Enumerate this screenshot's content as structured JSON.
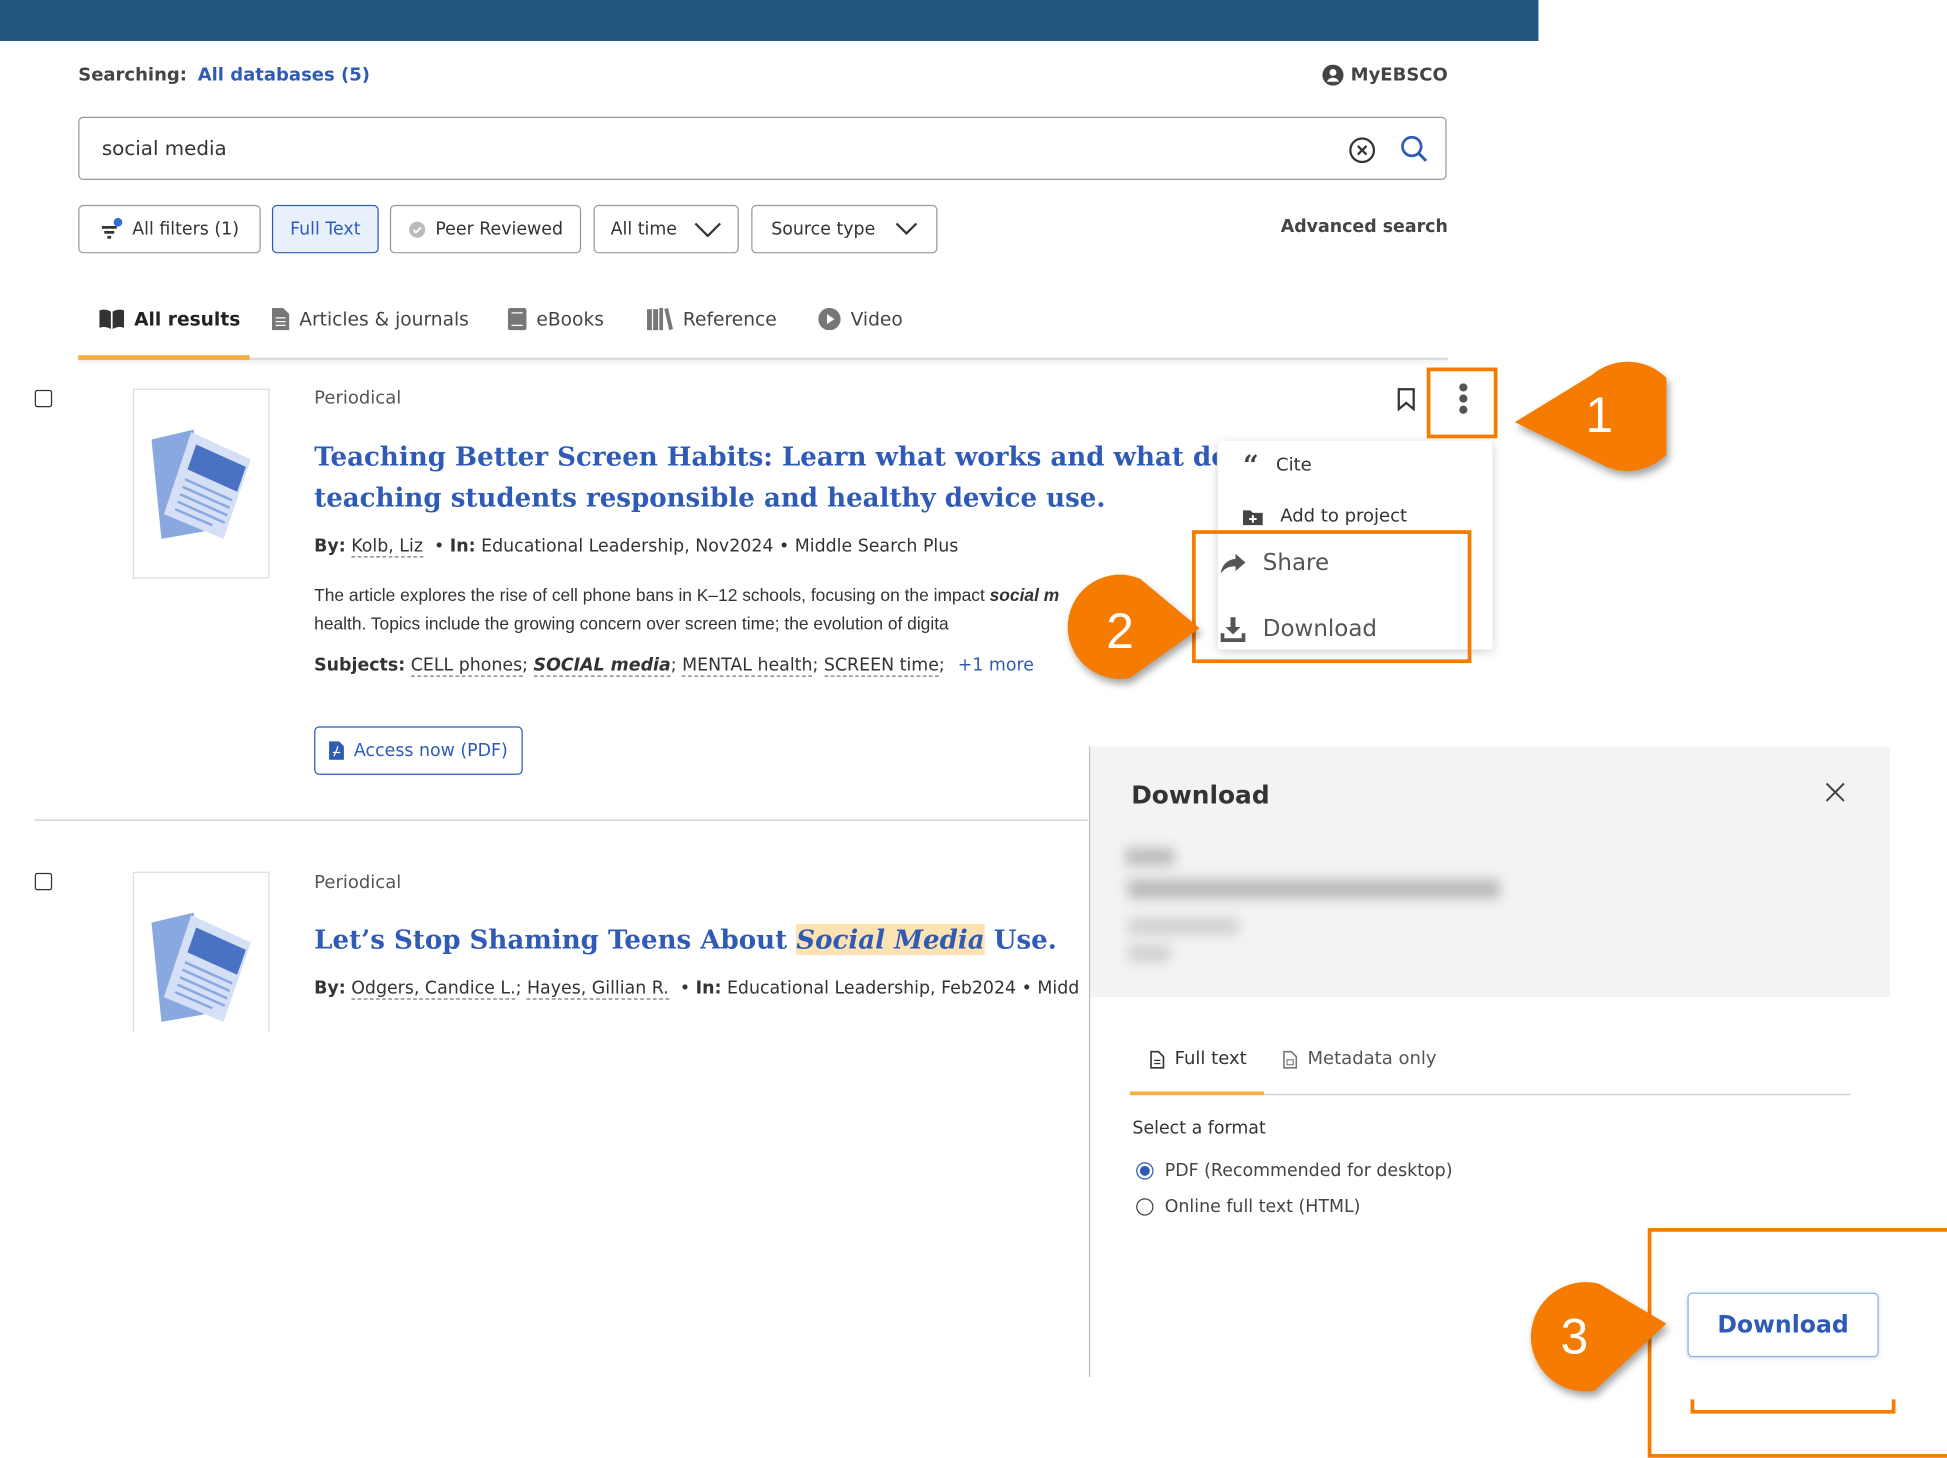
{
  "header": {
    "searching_label": "Searching:",
    "databases_link": "All databases (5)",
    "account_label": "MyEBSCO"
  },
  "search": {
    "value": "social media"
  },
  "filters": {
    "all_filters": "All filters (1)",
    "full_text": "Full Text",
    "peer_reviewed": "Peer Reviewed",
    "all_time": "All time",
    "source_type": "Source type",
    "advanced_search": "Advanced search"
  },
  "tabs": [
    {
      "label": "All results"
    },
    {
      "label": "Articles & journals"
    },
    {
      "label": "eBooks"
    },
    {
      "label": "Reference"
    },
    {
      "label": "Video"
    }
  ],
  "results": [
    {
      "type": "Periodical",
      "title_line1": "Teaching Better Screen Habits: Learn what works and what doesn",
      "title_line2": "teaching students responsible and healthy device use.",
      "by_label": "By:",
      "author": "Kolb, Liz",
      "in_label": "In:",
      "source": "Educational Leadership, Nov2024 • Middle Search Plus",
      "abstract_line1": "The article explores the rise of cell phone bans in K–12 schools, focusing on the impact",
      "abstract_line1_em": "social m",
      "abstract_line2": "health. Topics include the growing concern over screen time; the evolution of digita",
      "subjects_label": "Subjects:",
      "subjects": [
        "CELL phones",
        "SOCIAL media",
        "MENTAL health",
        "SCREEN time"
      ],
      "more": "+1 more",
      "access_button": "Access now (PDF)"
    },
    {
      "type": "Periodical",
      "title_before": "Let’s Stop Shaming Teens About ",
      "title_highlight": "Social Media",
      "title_after": " Use.",
      "by_label": "By:",
      "authors": [
        "Odgers, Candice L.",
        "Hayes, Gillian R."
      ],
      "in_label": "In:",
      "source": "Educational Leadership, Feb2024 • Midd"
    }
  ],
  "menu": {
    "cite": "Cite",
    "add_to_project": "Add to project",
    "share": "Share",
    "download": "Download"
  },
  "download_panel": {
    "title": "Download",
    "tabs": [
      {
        "label": "Full text"
      },
      {
        "label": "Metadata only"
      }
    ],
    "format_label": "Select a format",
    "options": [
      {
        "label": "PDF (Recommended for desktop)",
        "selected": true
      },
      {
        "label": "Online full text (HTML)",
        "selected": false
      }
    ],
    "download_button": "Download"
  },
  "callouts": [
    "1",
    "2",
    "3"
  ],
  "colors": {
    "topbar": "#22557f",
    "link": "#2f5bb7",
    "tab_active": "#f5b041",
    "callout": "#f57c00"
  }
}
